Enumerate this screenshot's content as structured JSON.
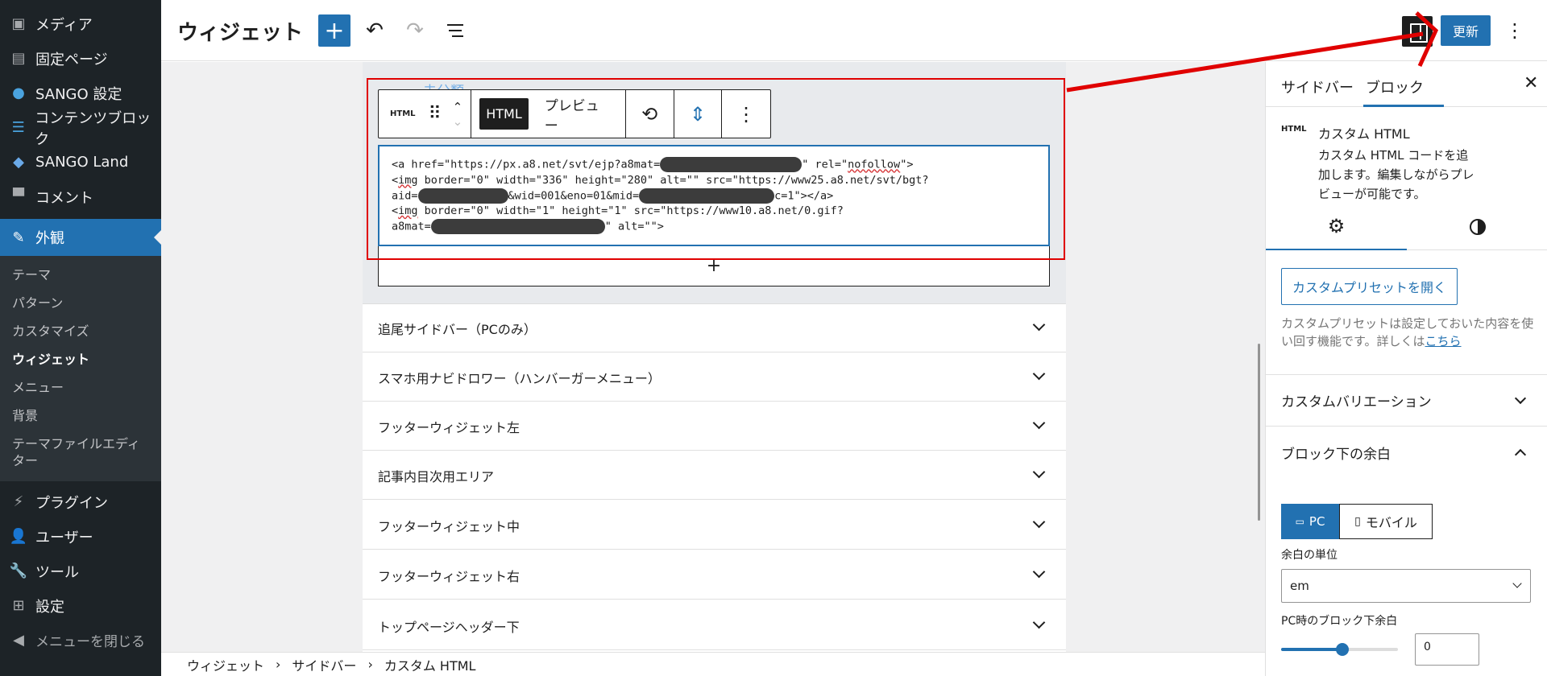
{
  "admin_menu": {
    "items_top": [
      {
        "label": "メディア",
        "icon": "media-icon"
      },
      {
        "label": "固定ページ",
        "icon": "pages-icon"
      },
      {
        "label": "SANGO 設定",
        "icon": "droplet-icon"
      },
      {
        "label": "コンテンツブロック",
        "icon": "content-block-icon"
      },
      {
        "label": "SANGO Land",
        "icon": "layers-icon"
      },
      {
        "label": "コメント",
        "icon": "comment-icon"
      }
    ],
    "current": {
      "label": "外観",
      "icon": "appearance-icon"
    },
    "submenu": [
      {
        "label": "テーマ"
      },
      {
        "label": "パターン"
      },
      {
        "label": "カスタマイズ"
      },
      {
        "label": "ウィジェット"
      },
      {
        "label": "メニュー"
      },
      {
        "label": "背景"
      },
      {
        "label": "テーマファイルエディター"
      }
    ],
    "items_bottom": [
      {
        "label": "プラグイン",
        "icon": "plugin-icon"
      },
      {
        "label": "ユーザー",
        "icon": "user-icon"
      },
      {
        "label": "ツール",
        "icon": "wrench-icon"
      },
      {
        "label": "設定",
        "icon": "settings-icon"
      }
    ],
    "collapse_label": "メニューを閉じる",
    "accent": "#2271b1"
  },
  "header": {
    "title": "ウィジェット",
    "inserter_glyph": "+",
    "undo_glyph": "↶",
    "redo_glyph": "↷",
    "update_label": "更新",
    "more_glyph": "⋮"
  },
  "canvas": {
    "faded_heading": "未分類",
    "toolbar": {
      "type_label": "HTML",
      "drag_glyph": "⠿",
      "up_glyph": "⌃",
      "down_glyph": "⌄",
      "html_tab": "HTML",
      "preview_tab": "プレビュー",
      "transform_glyph": "⟲",
      "spacing_glyph": "⇕",
      "options_glyph": "⋮"
    },
    "code": {
      "l1a": "<a href=\"https://px.a8.net/svt/ejp?a8mat=",
      "l1b": "\" rel=\"",
      "l1c": "nofollow",
      "l1d": "\">",
      "l2a": "<",
      "l2b": "img",
      "l2c": " border=\"0\" width=\"336\" height=\"280\" alt=\"\" src=\"https://www25.a8.net/svt/bgt?",
      "l3a": "aid=",
      "l3b": "&wid=001&eno=01&mid=",
      "l3c": "c=1\"></a>",
      "l4a": "<",
      "l4b": "img",
      "l4c": " border=\"0\" width=\"1\" height=\"1\" src=\"https://www10.a8.net/0.gif?",
      "l5a": "a8mat=",
      "l5b": "\" alt=\"\">"
    },
    "appender_glyph": "+",
    "areas": [
      {
        "label": "追尾サイドバー（PCのみ）"
      },
      {
        "label": "スマホ用ナビドロワー（ハンバーガーメニュー）"
      },
      {
        "label": "フッターウィジェット左"
      },
      {
        "label": "記事内目次用エリア"
      },
      {
        "label": "フッターウィジェット中"
      },
      {
        "label": "フッターウィジェット右"
      },
      {
        "label": "トップページヘッダー下"
      }
    ]
  },
  "breadcrumb": {
    "items": [
      "ウィジェット",
      "サイドバー",
      "カスタム HTML"
    ],
    "separator": "›"
  },
  "settings_sidebar": {
    "tab_sidebar": "サイドバー",
    "tab_block": "ブロック",
    "close_glyph": "✕",
    "card_icon": "HTML",
    "card_title": "カスタム HTML",
    "card_desc": "カスタム HTML コードを追加します。編集しながらプレビューが可能です。",
    "settings_glyph": "⚙",
    "preset_button": "カスタムプリセットを開く",
    "preset_desc": "カスタムプリセットは設定しておいた内容を使い回す機能です。詳しくは",
    "preset_link": "こちら",
    "panel_variation": "カスタムバリエーション",
    "panel_spacing": "ブロック下の余白",
    "device_pc": "PC",
    "device_mobile": "モバイル",
    "pc_glyph": "💻",
    "mobile_glyph": "📱",
    "unit_label": "余白の単位",
    "unit_value": "em",
    "pc_margin_label": "PC時のブロック下余白",
    "margin_value": "0"
  },
  "annotation_color": "#e00000"
}
